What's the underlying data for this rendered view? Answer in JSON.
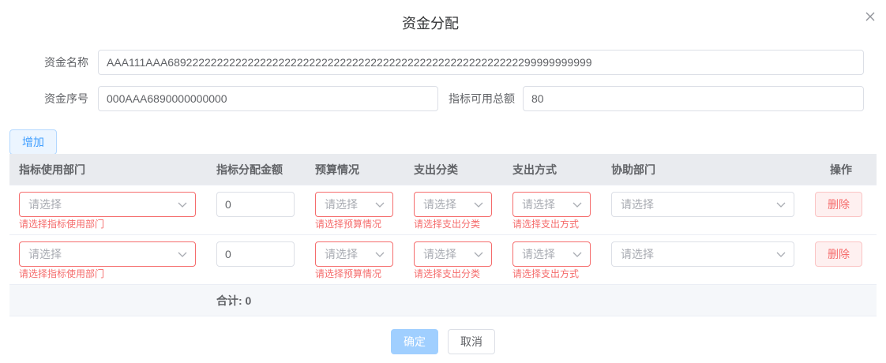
{
  "dialog": {
    "title": "资金分配",
    "close_icon": "close-icon"
  },
  "form": {
    "fund_name_label": "资金名称",
    "fund_name_value": "AAA111AAA689222222222222222222222222222222222222222222222222222222299999999999",
    "fund_no_label": "资金序号",
    "fund_no_value": "000AAA6890000000000",
    "total_label": "指标可用总额",
    "total_value": "80"
  },
  "toolbar": {
    "add_label": "增加"
  },
  "table": {
    "headers": {
      "dept": "指标使用部门",
      "amount": "指标分配金额",
      "budget": "预算情况",
      "category": "支出分类",
      "method": "支出方式",
      "assist": "协助部门",
      "action": "操作"
    },
    "placeholder": "请选择",
    "rows": [
      {
        "amount": "0",
        "dept_error": "请选择指标使用部门",
        "budget_error": "请选择预算情况",
        "category_error": "请选择支出分类",
        "method_error": "请选择支出方式",
        "delete_label": "删除"
      },
      {
        "amount": "0",
        "dept_error": "请选择指标使用部门",
        "budget_error": "请选择预算情况",
        "category_error": "请选择支出分类",
        "method_error": "请选择支出方式",
        "delete_label": "删除"
      }
    ],
    "sum_label": "合计: 0"
  },
  "footer": {
    "confirm_label": "确定",
    "cancel_label": "取消"
  },
  "colors": {
    "primary": "#409eff",
    "danger": "#f56c6c",
    "disabled_primary": "#a0cfff"
  }
}
